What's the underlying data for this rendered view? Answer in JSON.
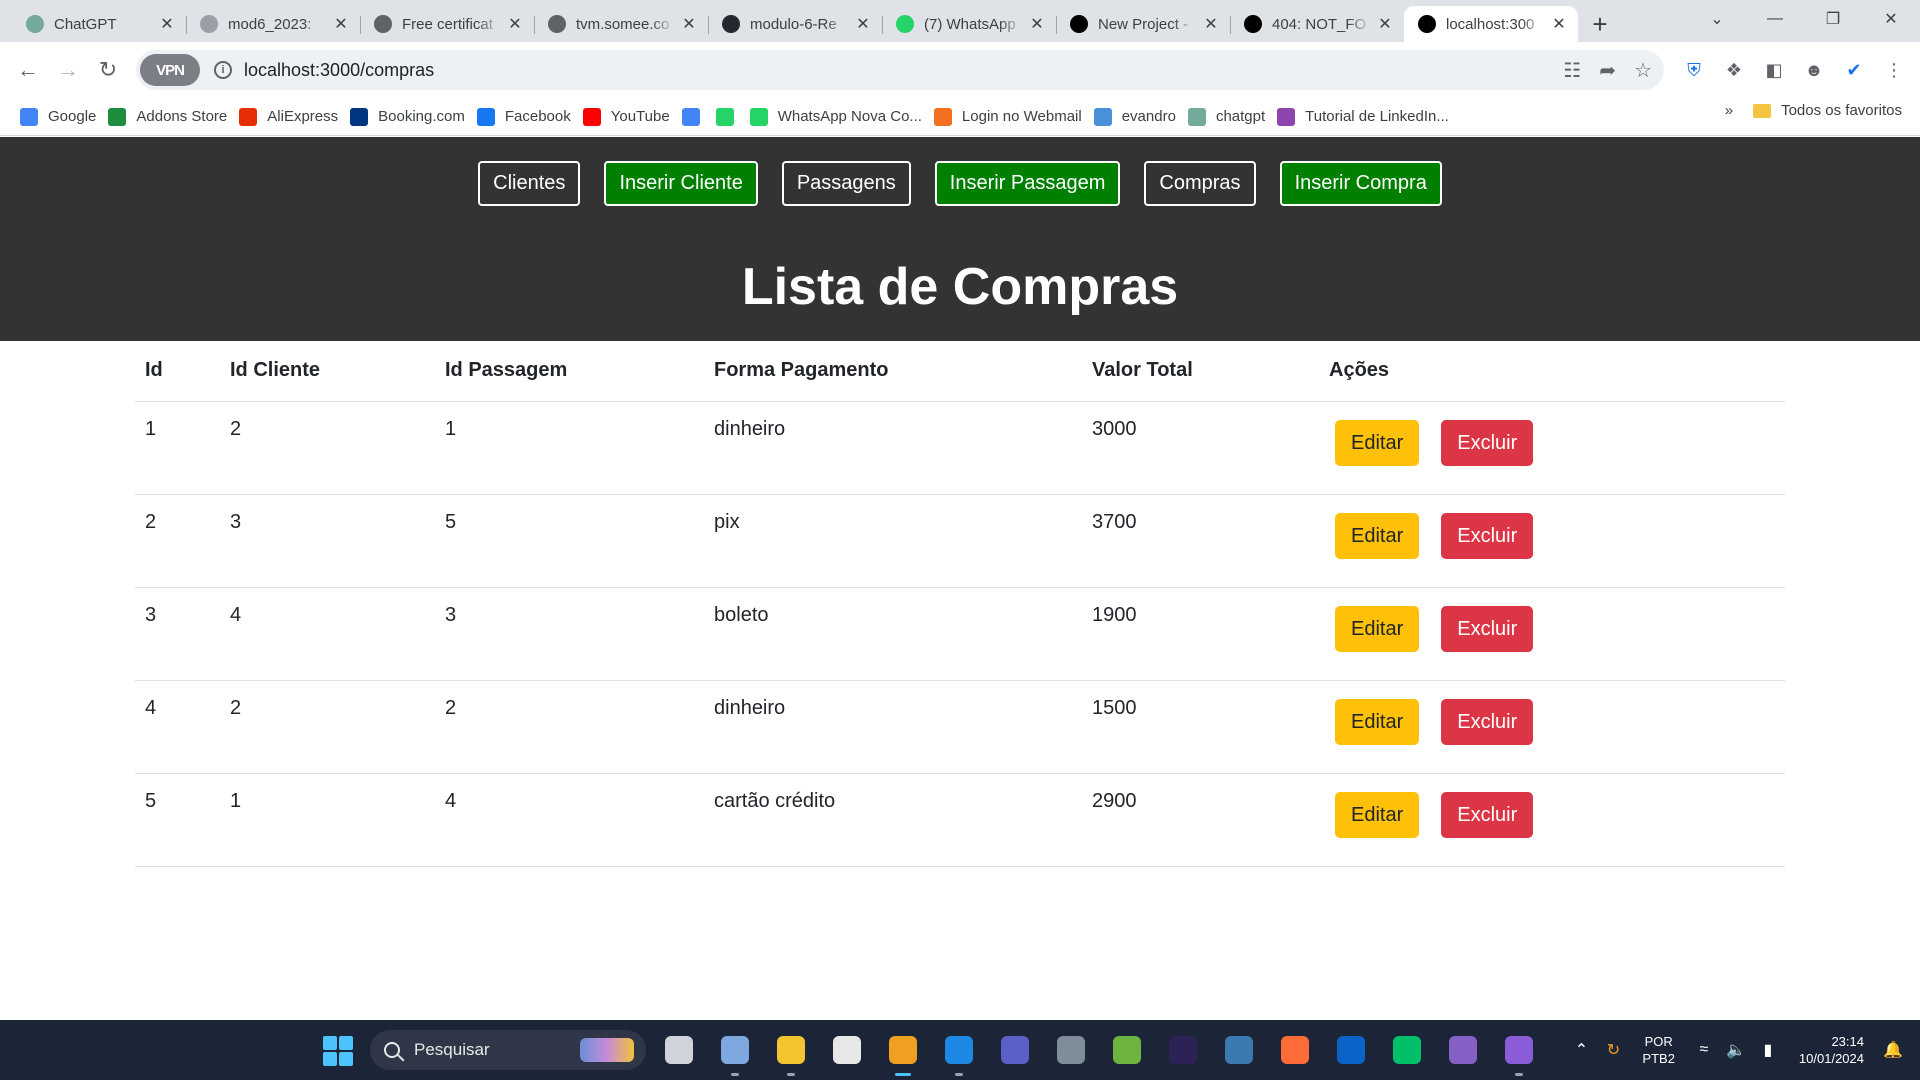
{
  "browser": {
    "tabs": [
      {
        "title": "ChatGPT",
        "icon": "chatgpt-icon",
        "color": "#74aa9c",
        "active": false
      },
      {
        "title": "mod6_2023: ",
        "icon": "document-icon",
        "color": "#9aa0a6",
        "active": false
      },
      {
        "title": "Free certificat",
        "icon": "globe-icon",
        "color": "#5f6368",
        "active": false
      },
      {
        "title": "tvm.somee.co",
        "icon": "globe-icon",
        "color": "#5f6368",
        "active": false
      },
      {
        "title": "modulo-6-Re",
        "icon": "github-icon",
        "color": "#24292f",
        "active": false
      },
      {
        "title": "(7) WhatsApp",
        "icon": "whatsapp-icon",
        "color": "#25d366",
        "active": false
      },
      {
        "title": "New Project - ",
        "icon": "vercel-icon",
        "color": "#000000",
        "active": false
      },
      {
        "title": "404: NOT_FO",
        "icon": "vercel-icon",
        "color": "#000000",
        "active": false
      },
      {
        "title": "localhost:300",
        "icon": "vercel-icon",
        "color": "#000000",
        "active": true
      }
    ],
    "url": "localhost:3000/compras",
    "vpn_label": "VPN",
    "bookmarks": [
      {
        "label": "Google",
        "icon": "google-icon",
        "color": "#4285f4"
      },
      {
        "label": "Addons Store",
        "icon": "addons-icon",
        "color": "#1e8e3e"
      },
      {
        "label": "AliExpress",
        "icon": "aliexpress-icon",
        "color": "#e62e04"
      },
      {
        "label": "Booking.com",
        "icon": "booking-icon",
        "color": "#003580"
      },
      {
        "label": "Facebook",
        "icon": "facebook-icon",
        "color": "#1877f2"
      },
      {
        "label": "YouTube",
        "icon": "youtube-icon",
        "color": "#ff0000"
      },
      {
        "label": "",
        "icon": "google-icon",
        "color": "#4285f4"
      },
      {
        "label": "",
        "icon": "whatsapp-icon",
        "color": "#25d366"
      },
      {
        "label": "WhatsApp Nova Co...",
        "icon": "whatsapp-icon",
        "color": "#25d366"
      },
      {
        "label": "Login no Webmail",
        "icon": "webmail-icon",
        "color": "#f37021"
      },
      {
        "label": "evandro",
        "icon": "page-icon",
        "color": "#4a90d9"
      },
      {
        "label": "chatgpt",
        "icon": "chatgpt-icon",
        "color": "#74aa9c"
      },
      {
        "label": "Tutorial de LinkedIn...",
        "icon": "linkedin-tutorial-icon",
        "color": "#8e44ad"
      }
    ],
    "bookmarks_overflow": "»",
    "all_bookmarks_label": "Todos os favoritos"
  },
  "app": {
    "nav": [
      {
        "label": "Clientes",
        "style": "outline"
      },
      {
        "label": "Inserir Cliente",
        "style": "green"
      },
      {
        "label": "Passagens",
        "style": "outline"
      },
      {
        "label": "Inserir Passagem",
        "style": "green"
      },
      {
        "label": "Compras",
        "style": "outline"
      },
      {
        "label": "Inserir Compra",
        "style": "green"
      }
    ],
    "title": "Lista de Compras",
    "table": {
      "headers": [
        "Id",
        "Id Cliente",
        "Id Passagem",
        "Forma Pagamento",
        "Valor Total",
        "Ações"
      ],
      "rows": [
        {
          "id": "1",
          "id_cliente": "2",
          "id_passagem": "1",
          "forma_pagamento": "dinheiro",
          "valor_total": "3000"
        },
        {
          "id": "2",
          "id_cliente": "3",
          "id_passagem": "5",
          "forma_pagamento": "pix",
          "valor_total": "3700"
        },
        {
          "id": "3",
          "id_cliente": "4",
          "id_passagem": "3",
          "forma_pagamento": "boleto",
          "valor_total": "1900"
        },
        {
          "id": "4",
          "id_cliente": "2",
          "id_passagem": "2",
          "forma_pagamento": "dinheiro",
          "valor_total": "1500"
        },
        {
          "id": "5",
          "id_cliente": "1",
          "id_passagem": "4",
          "forma_pagamento": "cartão crédito",
          "valor_total": "2900"
        }
      ],
      "edit_label": "Editar",
      "delete_label": "Excluir"
    },
    "colors": {
      "header_bg": "#333333",
      "green_button": "#008000",
      "edit_button": "#ffc107",
      "delete_button": "#dc3545"
    }
  },
  "taskbar": {
    "search_placeholder": "Pesquisar",
    "apps": [
      {
        "name": "task-view-icon",
        "color": "#d0d4da",
        "running": false
      },
      {
        "name": "snipping-tool-icon",
        "color": "#7fa7e0",
        "running": true
      },
      {
        "name": "file-explorer-icon",
        "color": "#f4c430",
        "running": true
      },
      {
        "name": "microsoft-store-icon",
        "color": "#e8e8e8",
        "running": false
      },
      {
        "name": "brave-browser-icon",
        "color": "#f0a020",
        "running": true,
        "active": true
      },
      {
        "name": "vscode-icon",
        "color": "#1e88e5",
        "running": true
      },
      {
        "name": "teams-icon",
        "color": "#5b5fc7",
        "running": false
      },
      {
        "name": "calculator-icon",
        "color": "#7f8c9a",
        "running": false
      },
      {
        "name": "spring-tools-icon",
        "color": "#6db33f",
        "running": false
      },
      {
        "name": "eclipse-icon",
        "color": "#2c2255",
        "running": false
      },
      {
        "name": "mysql-workbench-icon",
        "color": "#3b7ab0",
        "running": false
      },
      {
        "name": "postman-icon",
        "color": "#ff6c37",
        "running": false
      },
      {
        "name": "outlook-icon",
        "color": "#0a64c8",
        "running": false
      },
      {
        "name": "mongodb-compass-icon",
        "color": "#00c16a",
        "running": false
      },
      {
        "name": "visual-studio-icon",
        "color": "#8661c5",
        "running": false
      },
      {
        "name": "media-player-icon",
        "color": "#8a5cd8",
        "running": true
      }
    ],
    "lang_line1": "POR",
    "lang_line2": "PTB2",
    "time": "23:14",
    "date": "10/01/2024"
  }
}
